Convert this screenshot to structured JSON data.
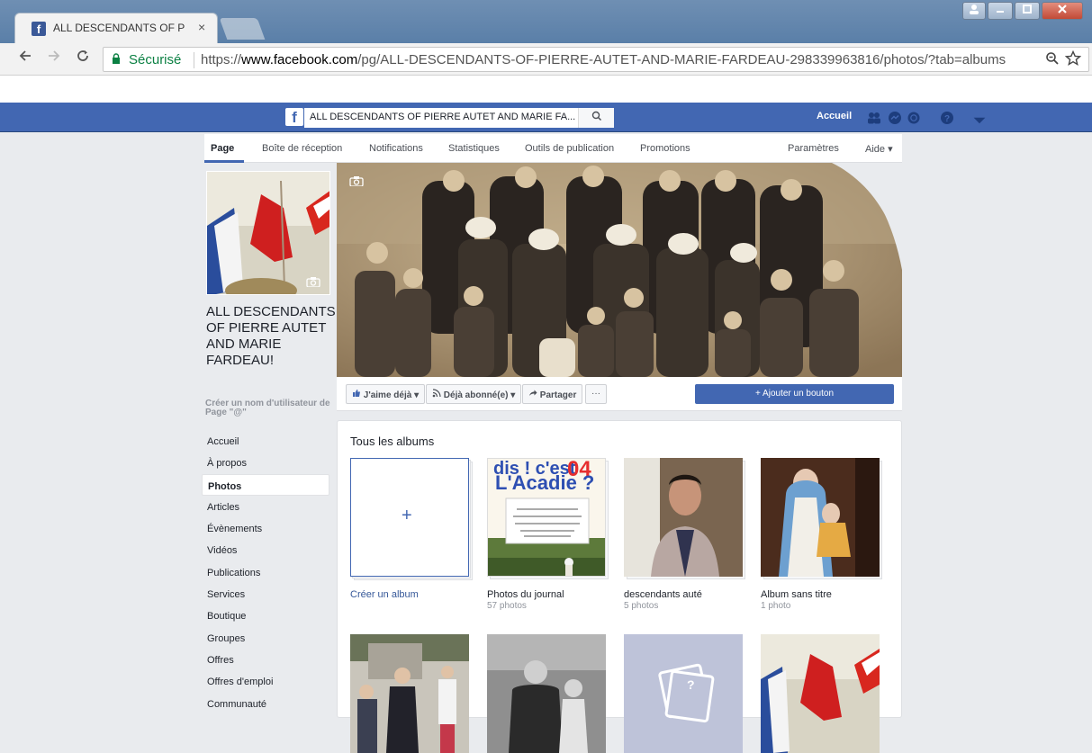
{
  "browser": {
    "tab_title": "ALL DESCENDANTS OF P",
    "tab_close": "×",
    "security_label": "Sécurisé",
    "url_scheme": "https://",
    "url_host": "www.facebook.com",
    "url_path": "/pg/ALL-DESCENDANTS-OF-PIERRE-AUTET-AND-MARIE-FARDEAU-298339963816/photos/?tab=albums",
    "icons": {
      "back": "back-arrow-icon",
      "forward": "forward-arrow-icon",
      "reload": "reload-icon",
      "zoom": "zoom-icon",
      "bookmark": "star-icon"
    }
  },
  "fb_header": {
    "search_value": "ALL DESCENDANTS OF PIERRE AUTET AND MARIE FA...",
    "home_label": "Accueil",
    "brand_color": "#4267b2"
  },
  "page_nav": {
    "tabs": [
      "Page",
      "Boîte de réception",
      "Notifications",
      "Statistiques",
      "Outils de publication",
      "Promotions"
    ],
    "settings": "Paramètres",
    "help": "Aide ▾"
  },
  "profile": {
    "page_name": "ALL DESCENDANTS OF PIERRE AUTET AND MARIE FARDEAU!",
    "username_prompt": "Créer un nom d'utilisateur de Page \"@\""
  },
  "left_nav": [
    "Accueil",
    "À propos",
    "Photos",
    "Articles",
    "Évènements",
    "Vidéos",
    "Publications",
    "Services",
    "Boutique",
    "Groupes",
    "Offres",
    "Offres d'emploi",
    "Communauté"
  ],
  "cover_actions": {
    "like": "J'aime déjà ▾",
    "follow": "Déjà abonné(e) ▾",
    "share": "Partager",
    "more": "···",
    "add_button": "+ Ajouter un bouton"
  },
  "albums": {
    "title": "Tous les albums",
    "create_label": "Créer un album",
    "plus": "+",
    "items": [
      {
        "name": "Photos du journal",
        "count": "57 photos"
      },
      {
        "name": "descendants auté",
        "count": "5 photos"
      },
      {
        "name": "Album sans titre",
        "count": "1 photo"
      }
    ],
    "thumb_texts": {
      "poster_top": "dis ! c'est",
      "poster_num": "04",
      "poster_big": "L'Acadie ?",
      "placeholder": "?"
    }
  }
}
